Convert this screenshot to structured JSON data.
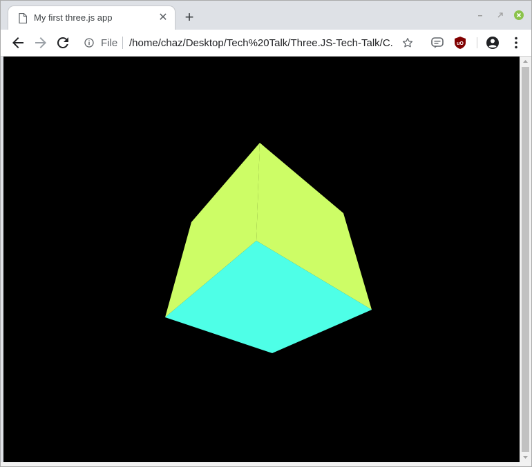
{
  "tab": {
    "title": "My first three.js app",
    "close_glyph": "✕",
    "doc_icon": "document-icon"
  },
  "new_tab_glyph": "+",
  "window_controls": {
    "minimize_icon": "minimize-icon",
    "maximize_icon": "maximize-icon",
    "close_icon": "close-icon",
    "close_color": "#8bc34a"
  },
  "toolbar": {
    "back_icon": "back-arrow-icon",
    "forward_icon": "forward-arrow-icon",
    "reload_icon": "reload-icon",
    "bookmark_icon": "star-icon",
    "extensions": [
      "chat-extension-icon",
      "ublock-icon"
    ],
    "profile_icon": "profile-icon",
    "menu_icon": "kebab-menu-icon"
  },
  "omnibox": {
    "scheme": "File",
    "url": "/home/chaz/Desktop/Tech%20Talk/Three.JS-Tech-Talk/C..."
  },
  "scene": {
    "background": "#000000",
    "cube_top_color": "#cdfd66",
    "cube_side_color": "#cdfd66",
    "cube_bottom_color": "#4effe7"
  }
}
